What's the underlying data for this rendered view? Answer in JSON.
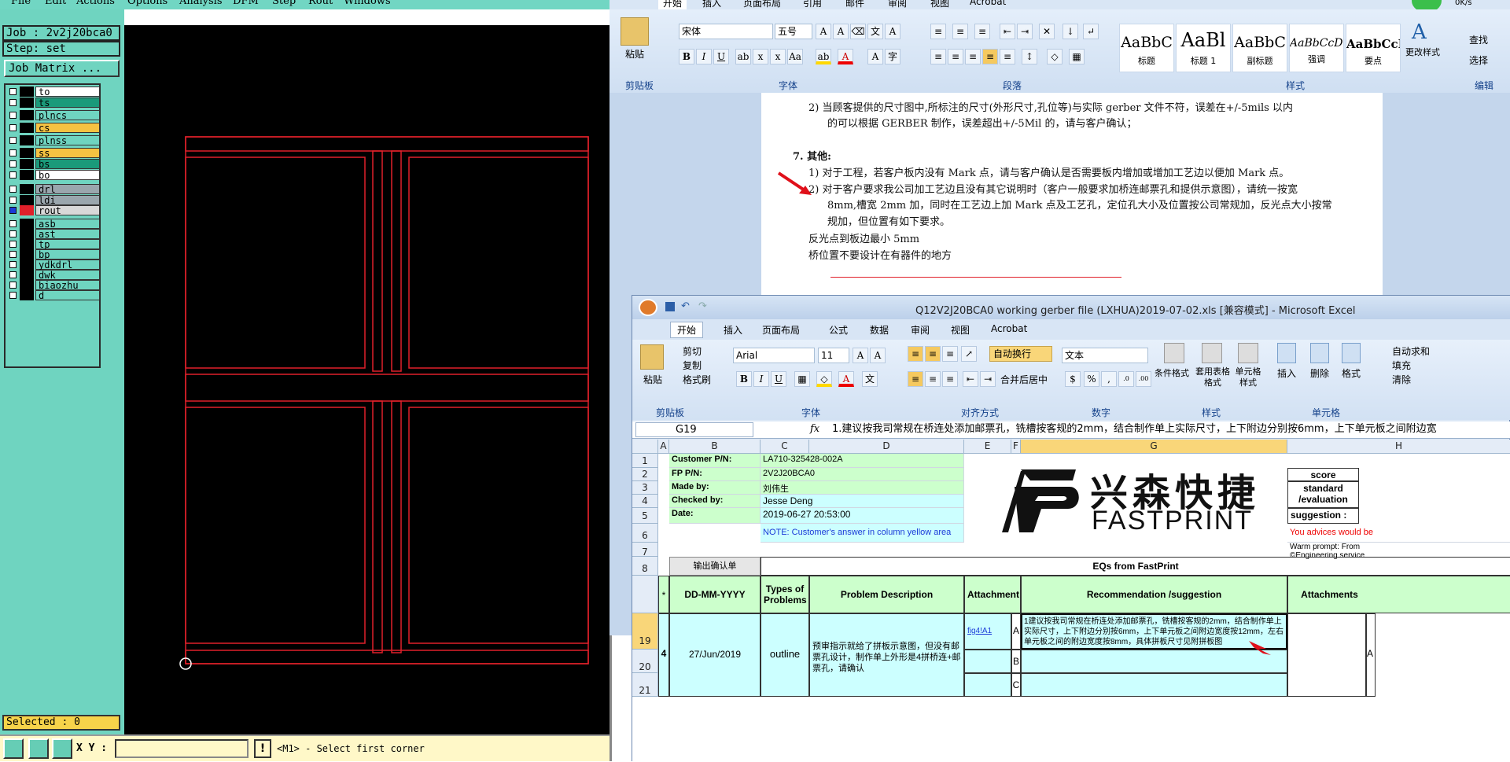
{
  "cam": {
    "menu": [
      "File",
      "Edit",
      "Actions",
      "Options",
      "Analysis",
      "DFM",
      "Step",
      "Rout",
      "Windows"
    ],
    "job": "Job : 2v2j20bca0",
    "step": "Step: set",
    "job_matrix_button": "Job Matrix ...",
    "layers": [
      {
        "name": "to",
        "color": "#ffffff"
      },
      {
        "name": "ts",
        "color": "#1a9a7a"
      },
      {
        "name": "plncs",
        "color": "#6fd4c0"
      },
      {
        "name": "cs",
        "color": "#f5c242"
      },
      {
        "name": "plnss",
        "color": "#6fd4c0"
      },
      {
        "name": "ss",
        "color": "#f5c242"
      },
      {
        "name": "bs",
        "color": "#1a9a7a"
      },
      {
        "name": "bo",
        "color": "#ffffff"
      },
      {
        "name": "drl",
        "color": "#9aa6ad"
      },
      {
        "name": "ldi",
        "color": "#9aa6ad"
      },
      {
        "name": "rout",
        "color": "#d8d8d8"
      },
      {
        "name": "asb",
        "color": "#6fd4c0"
      },
      {
        "name": "ast",
        "color": "#6fd4c0"
      },
      {
        "name": "tp",
        "color": "#6fd4c0"
      },
      {
        "name": "bp",
        "color": "#6fd4c0"
      },
      {
        "name": "ydkdrl",
        "color": "#6fd4c0"
      },
      {
        "name": "dwk",
        "color": "#6fd4c0"
      },
      {
        "name": "biaozhu",
        "color": "#6fd4c0"
      },
      {
        "name": "d",
        "color": "#6fd4c0"
      }
    ],
    "selected": "Selected : 0",
    "xy_label": "X Y :",
    "excl": "!",
    "prompt": "<M1> - Select first corner",
    "outline_color": "#e0202a"
  },
  "word": {
    "tabs": [
      "开始",
      "插入",
      "页面布局",
      "引用",
      "邮件",
      "审阅",
      "视图",
      "Acrobat"
    ],
    "paste": "粘贴",
    "font_name": "宋体",
    "font_size": "五号",
    "group_labels": {
      "clipboard": "剪贴板",
      "font": "字体",
      "paragraph": "段落",
      "styles": "样式",
      "edit": "编辑"
    },
    "styles": [
      {
        "sample": "AaBbC",
        "name": "标题"
      },
      {
        "sample": "AaBl",
        "name": "标题 1"
      },
      {
        "sample": "AaBbC",
        "name": "副标题"
      },
      {
        "sample": "AaBbCcDt",
        "name": "强调"
      },
      {
        "sample": "AaBbCcD",
        "name": "要点"
      }
    ],
    "change_styles": "更改样式",
    "find": "查找",
    "select": "选择",
    "speed": "0K/s",
    "doc": {
      "l1": "2)  当顾客提供的尺寸图中,所标注的尺寸(外形尺寸,孔位等)与实际 gerber 文件不符，误差在+/-5mils 以内",
      "l2": "的可以根据 GERBER 制作，误差超出+/-5Mil 的，请与客户确认；",
      "l3": "7.  其他:",
      "l4": "1)  对于工程，若客户板内没有 Mark 点，请与客户确认是否需要板内增加或增加工艺边以便加 Mark 点。",
      "l5": "2)  对于客户要求我公司加工艺边且没有其它说明时（客户一般要求加桥连邮票孔和提供示意图），请统一按宽",
      "l6": "8mm,槽宽 2mm 加，同时在工艺边上加 Mark 点及工艺孔，定位孔大小及位置按公司常规加，反光点大小按常",
      "l7": "规加，但位置有如下要求。",
      "l8": "反光点到板边最小 5mm",
      "l9": "桥位置不要设计在有器件的地方"
    }
  },
  "excel": {
    "title": "Q12V2J20BCA0 working gerber file (LXHUA)2019-07-02.xls  [兼容模式] - Microsoft Excel",
    "tabs": [
      "开始",
      "插入",
      "页面布局",
      "公式",
      "数据",
      "审阅",
      "视图",
      "Acrobat"
    ],
    "ribbon": {
      "cut": "剪切",
      "copy": "复制",
      "format_painter": "格式刷",
      "paste": "粘贴",
      "font": "Arial",
      "size": "11",
      "wrap": "自动换行",
      "merge": "合并后居中",
      "numfmt": "文本",
      "cond": "条件格式",
      "table_fmt": "套用表格格式",
      "cell_style": "单元格样式",
      "insert": "插入",
      "delete": "删除",
      "format": "格式",
      "autosum": "自动求和",
      "fill": "填充",
      "clear": "清除",
      "g_clip": "剪贴板",
      "g_font": "字体",
      "g_align": "对齐方式",
      "g_num": "数字",
      "g_style": "样式",
      "g_cells": "单元格"
    },
    "name_box": "G19",
    "fx": "fx",
    "formula": "1.建议按我司常规在桥连处添加邮票孔，铣槽按客规的2mm，结合制作单上实际尺寸，上下附边分别按6mm，上下单元板之间附边宽",
    "cols": [
      "A",
      "B",
      "C",
      "D",
      "E",
      "F",
      "G",
      "H"
    ],
    "rows": [
      "1",
      "2",
      "3",
      "4",
      "5",
      "6",
      "7",
      "8",
      "",
      "19",
      "20",
      "21"
    ],
    "labels": {
      "customer_pn": "Customer P/N:",
      "fp_pn": "FP P/N:",
      "made_by": "Made by:",
      "checked_by": "Checked by:",
      "date": "Date:"
    },
    "values": {
      "customer_pn": "LA710-325428-002A",
      "fp_pn": "2V2J20BCA0",
      "made_by": "刘伟生",
      "checked_by": "Jesse Deng",
      "date": "2019-06-27 20:53:00"
    },
    "note": "NOTE: Customer's  answer in column yellow area",
    "logo_cn": "兴森快捷",
    "logo_en": "FASTPRINT",
    "score": "score",
    "standard": "standard /evaluation",
    "suggestion_lbl": "suggestion :",
    "advice": "You advices would be",
    "warm": "Warm prompt: From",
    "eng": "©Engineering service",
    "out_confirm": "输出确认单",
    "eqs_title": "EQs from FastPrint",
    "headers": {
      "star": "*",
      "date": "DD-MM-YYYY",
      "types": "Types of Problems",
      "desc": "Problem Description",
      "attach": "Attachment",
      "rec": "Recommendation /suggestion",
      "attachs": "Attachments"
    },
    "row": {
      "no": "4",
      "date": "27/Jun/2019",
      "type": "outline",
      "desc": "预审指示就给了拼板示意图，但没有邮票孔设计，制作单上外形是4拼桥连+邮票孔，请确认",
      "attach": "fig4!A1",
      "sub_a": "A",
      "sub_b": "B",
      "sub_c": "C",
      "rec": "1建议按我司常规在桥连处添加邮票孔，铣槽按客规的2mm，结合制作单上实际尺寸，上下附边分别按6mm，上下单元板之间附边宽度按12mm，左右单元板之间的附边宽度按8mm，具体拼板尺寸见附拼板图",
      "h_a": "A"
    }
  }
}
